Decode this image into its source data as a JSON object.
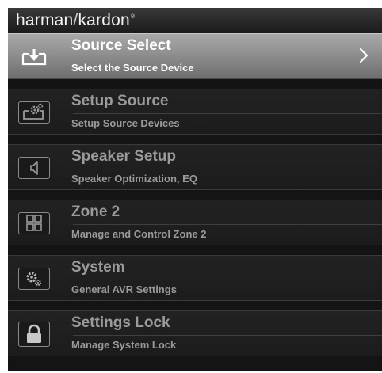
{
  "brand": {
    "part1": "harman",
    "separator": "/",
    "part2": "kardon",
    "reg_mark": "®"
  },
  "colors": {
    "selected_accent": "#8f8f8f",
    "background": "#141414",
    "text_dim": "#9a9a9a",
    "text_selected": "#ffffff"
  },
  "menu": {
    "items": [
      {
        "title": "Source Select",
        "subtitle": "Select the Source Device",
        "icon": "source-input-icon",
        "selected": true
      },
      {
        "title": "Setup Source",
        "subtitle": "Setup Source Devices",
        "icon": "source-gear-icon",
        "selected": false
      },
      {
        "title": "Speaker Setup",
        "subtitle": "Speaker Optimization, EQ",
        "icon": "speaker-icon",
        "selected": false
      },
      {
        "title": "Zone 2",
        "subtitle": "Manage and Control Zone 2",
        "icon": "grid-icon",
        "selected": false
      },
      {
        "title": "System",
        "subtitle": "General AVR Settings",
        "icon": "gears-icon",
        "selected": false
      },
      {
        "title": "Settings Lock",
        "subtitle": "Manage System Lock",
        "icon": "lock-icon",
        "selected": false
      }
    ]
  }
}
